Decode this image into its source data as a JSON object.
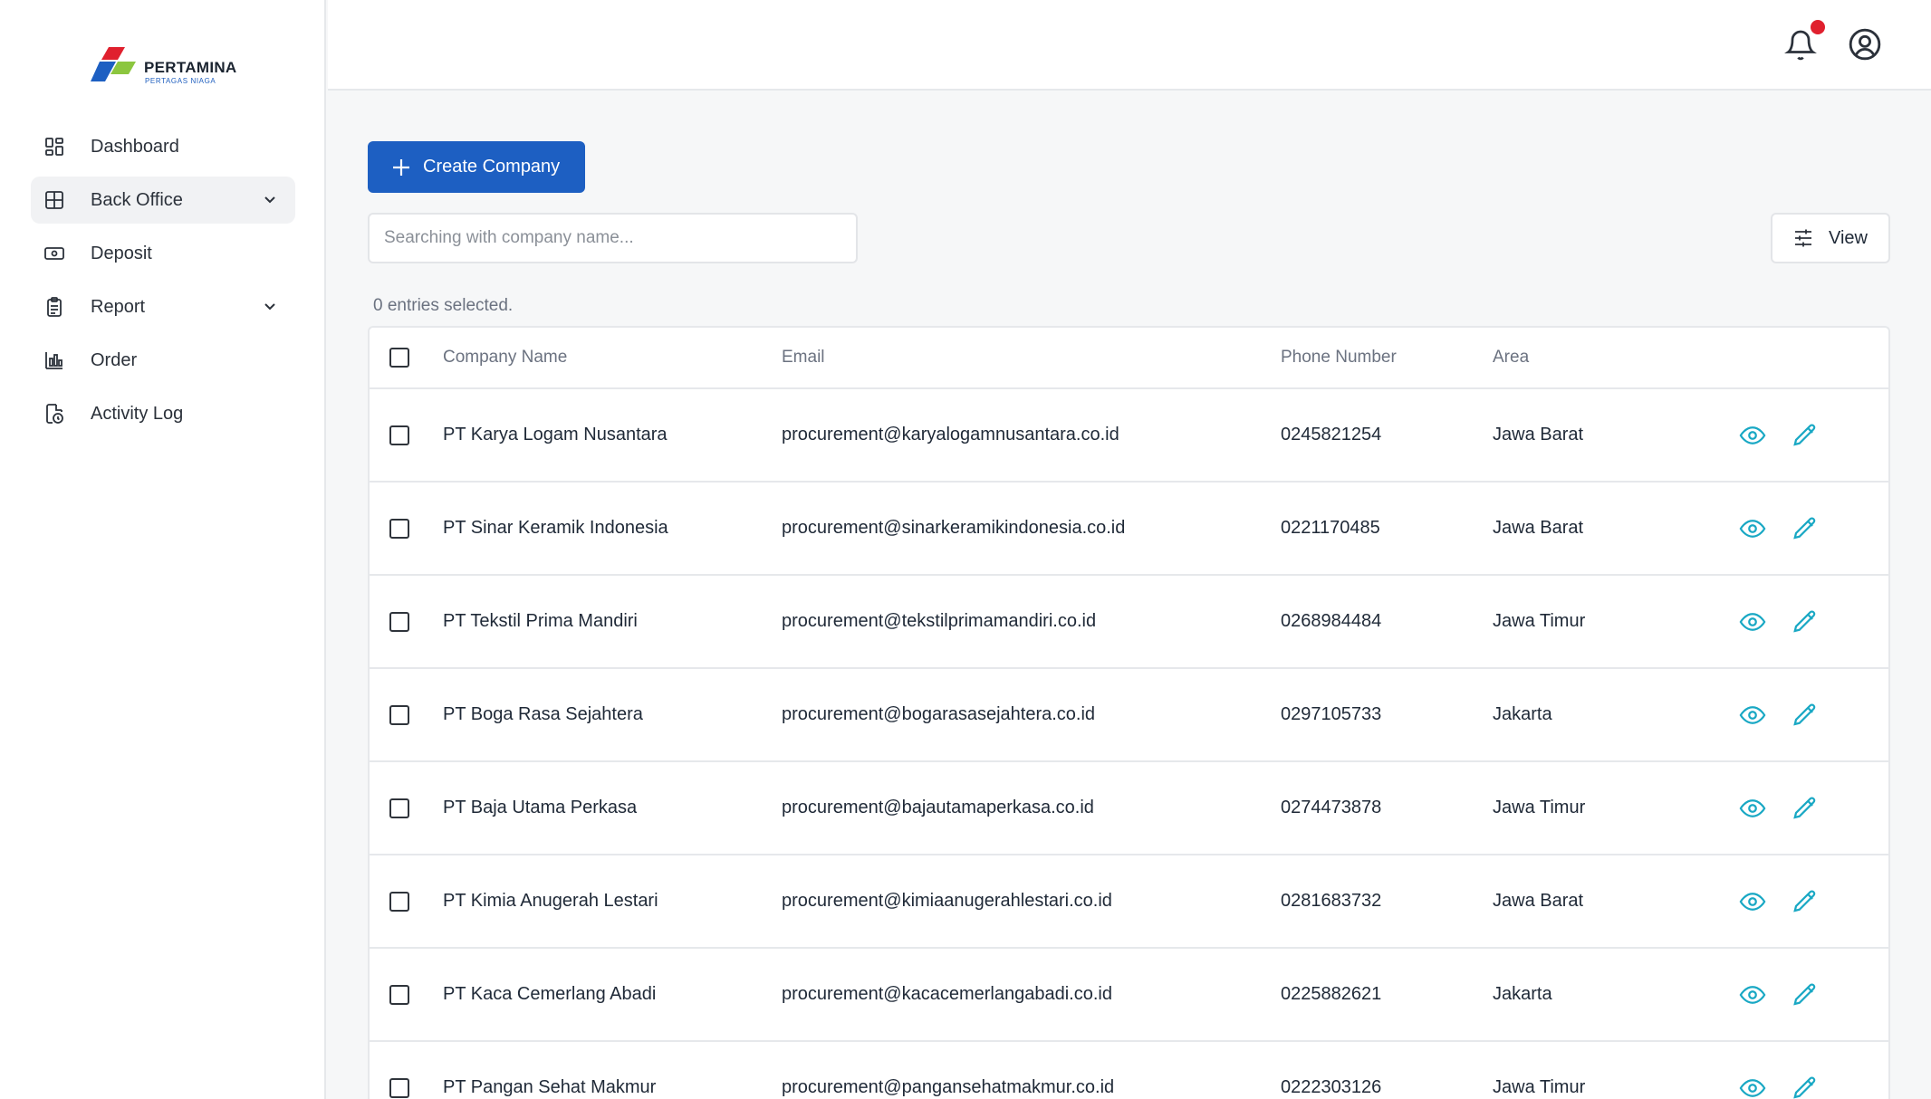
{
  "brand": {
    "name": "PERTAMINA",
    "subtitle": "PERTAGAS NIAGA",
    "colors": {
      "red": "#e0202e",
      "blue": "#1d5fc2",
      "green": "#8cc63f"
    }
  },
  "sidebar": {
    "items": [
      {
        "label": "Dashboard",
        "icon": "dashboard-grid-icon",
        "active": false,
        "has_chevron": false
      },
      {
        "label": "Back Office",
        "icon": "table-grid-icon",
        "active": true,
        "has_chevron": true
      },
      {
        "label": "Deposit",
        "icon": "cash-icon",
        "active": false,
        "has_chevron": false
      },
      {
        "label": "Report",
        "icon": "clipboard-icon",
        "active": false,
        "has_chevron": true
      },
      {
        "label": "Order",
        "icon": "bar-chart-icon",
        "active": false,
        "has_chevron": false
      },
      {
        "label": "Activity Log",
        "icon": "file-clock-icon",
        "active": false,
        "has_chevron": false
      }
    ]
  },
  "header": {
    "notification_icon": "bell-icon",
    "has_unread": true,
    "user_icon": "user-circle-icon"
  },
  "toolbar": {
    "create_label": "Create Company",
    "search_placeholder": "Searching with company name...",
    "search_value": "",
    "view_label": "View",
    "entries_text": "0 entries selected."
  },
  "table": {
    "columns": [
      "Company Name",
      "Email",
      "Phone Number",
      "Area"
    ],
    "rows": [
      {
        "name": "PT Karya Logam Nusantara",
        "email": "procurement@karyalogamnusantara.co.id",
        "phone": "0245821254",
        "area": "Jawa Barat"
      },
      {
        "name": "PT Sinar Keramik Indonesia",
        "email": "procurement@sinarkeramikindonesia.co.id",
        "phone": "0221170485",
        "area": "Jawa Barat"
      },
      {
        "name": "PT Tekstil Prima Mandiri",
        "email": "procurement@tekstilprimamandiri.co.id",
        "phone": "0268984484",
        "area": "Jawa Timur"
      },
      {
        "name": "PT Boga Rasa Sejahtera",
        "email": "procurement@bogarasasejahtera.co.id",
        "phone": "0297105733",
        "area": "Jakarta"
      },
      {
        "name": "PT Baja Utama Perkasa",
        "email": "procurement@bajautamaperkasa.co.id",
        "phone": "0274473878",
        "area": "Jawa Timur"
      },
      {
        "name": "PT Kimia Anugerah Lestari",
        "email": "procurement@kimiaanugerahlestari.co.id",
        "phone": "0281683732",
        "area": "Jawa Barat"
      },
      {
        "name": "PT Kaca Cemerlang Abadi",
        "email": "procurement@kacacemerlangabadi.co.id",
        "phone": "0225882621",
        "area": "Jakarta"
      },
      {
        "name": "PT Pangan Sehat Makmur",
        "email": "procurement@pangansehatmakmur.co.id",
        "phone": "0222303126",
        "area": "Jawa Timur"
      }
    ],
    "action_color": "#19a8c4"
  }
}
